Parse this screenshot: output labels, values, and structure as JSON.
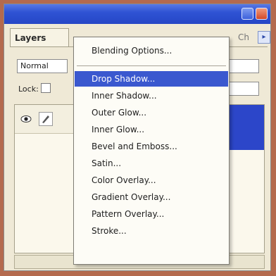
{
  "colors": {
    "titlebar": "#2f53d4",
    "selection": "#3a58cf",
    "menu_bg": "#fdfcf6",
    "panel_bg": "#efe9d6"
  },
  "panel": {
    "tabs": [
      {
        "label": "Layers"
      },
      {
        "label": "Ch"
      }
    ],
    "menu_button_icon": "triangle-right-icon",
    "blend_mode": "Normal",
    "lock_label": "Lock:"
  },
  "context_menu": {
    "items": [
      {
        "label": "Blending Options...",
        "selected": false
      },
      {
        "label": "Drop Shadow...",
        "selected": true
      },
      {
        "label": "Inner Shadow...",
        "selected": false
      },
      {
        "label": "Outer Glow...",
        "selected": false
      },
      {
        "label": "Inner Glow...",
        "selected": false
      },
      {
        "label": "Bevel and Emboss...",
        "selected": false
      },
      {
        "label": "Satin...",
        "selected": false
      },
      {
        "label": "Color Overlay...",
        "selected": false
      },
      {
        "label": "Gradient Overlay...",
        "selected": false
      },
      {
        "label": "Pattern Overlay...",
        "selected": false
      },
      {
        "label": "Stroke...",
        "selected": false
      }
    ]
  },
  "icons": {
    "eye": "eye-icon",
    "brush": "brush-icon"
  }
}
